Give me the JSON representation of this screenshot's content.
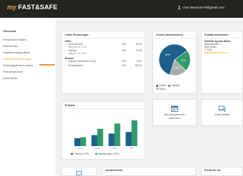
{
  "header": {
    "logo_prefix": "my",
    "logo_brand": "FAST&SAFE",
    "user_label": "User Benutzer79@gmail.com"
  },
  "sidebar": {
    "items": [
      {
        "label": "Übersicht",
        "state": "header"
      },
      {
        "label": "Persönliche Daten",
        "state": "normal"
      },
      {
        "label": "Nachrichten",
        "state": "normal"
      },
      {
        "label": "Versicherungspolicen",
        "state": "normal"
      },
      {
        "label": "Prämienabrechnungen",
        "state": "active"
      },
      {
        "label": "Leistungsabrechnungen",
        "state": "normal"
      },
      {
        "label": "Prämienrechner",
        "state": "normal"
      },
      {
        "label": "Dokumente",
        "state": "normal"
      }
    ]
  },
  "claims": {
    "title": "Letzte Rechnungen",
    "open_label": "Offen",
    "paid_label": "Bezahlt",
    "open": [
      {
        "name": "Schulzahnarzt",
        "sub": "fällig am 16.11.16",
        "currency": "CHF",
        "amount": "80.00",
        "icon": "pending-icon"
      },
      {
        "name": "Prämien",
        "sub": "fällig am 31.11.16",
        "currency": "CHF",
        "amount": "37.80",
        "icon": "pending-icon"
      }
    ],
    "paid": [
      {
        "name": "Prämien (September 2016)",
        "sub": "",
        "currency": "CHF",
        "amount": "37.80",
        "icon": "check-icon"
      },
      {
        "name": "Schulzahnarzt",
        "sub": "",
        "currency": "CHF",
        "amount": "238.40",
        "icon": "check-icon"
      }
    ]
  },
  "pie": {
    "title": "Kosten Aktivsonderer...",
    "slices": [
      {
        "label": "Vollaus",
        "value": 60,
        "color": "#1e5f8c",
        "text": "60%"
      },
      {
        "label": "Halbpflic",
        "value": 22,
        "color": "#2f9a6a",
        "text": "22%"
      },
      {
        "label": "Option",
        "value": 18,
        "color": "#a8acaf",
        "text": "18%"
      }
    ]
  },
  "contact": {
    "title": "Kontakt aufnehmen",
    "name": "FastSafe Agentur Baden",
    "lines": [
      "Bäckerstrasse 3",
      "5400 Baden",
      "T: 0041"
    ],
    "email": "baden@fastandsafe.ch"
  },
  "premium": {
    "title": "Prämien",
    "legend": [
      "Prämien (CHF)",
      "Auszahlungen (CHF)"
    ],
    "colors": [
      "#1e5f8c",
      "#2f9a6a"
    ]
  },
  "chart_data": {
    "type": "bar",
    "title": "Prämien",
    "categories": [
      "2014",
      "2015",
      "2016",
      "2017"
    ],
    "series": [
      {
        "name": "Prämien (CHF)",
        "values": [
          25,
          35,
          40,
          45
        ]
      },
      {
        "name": "Auszahlungen (CHF)",
        "values": [
          28,
          55,
          72,
          82
        ]
      }
    ],
    "ylim": [
      0,
      100
    ],
    "legend": "bottom"
  },
  "actions": {
    "download_label_1": "Beratungstermin",
    "download_label_2": "anfordern",
    "chat_label": "Chat starten"
  },
  "bottom": {
    "card2_title": "Kundenkriterie",
    "card3_title": "Events für Sie"
  }
}
